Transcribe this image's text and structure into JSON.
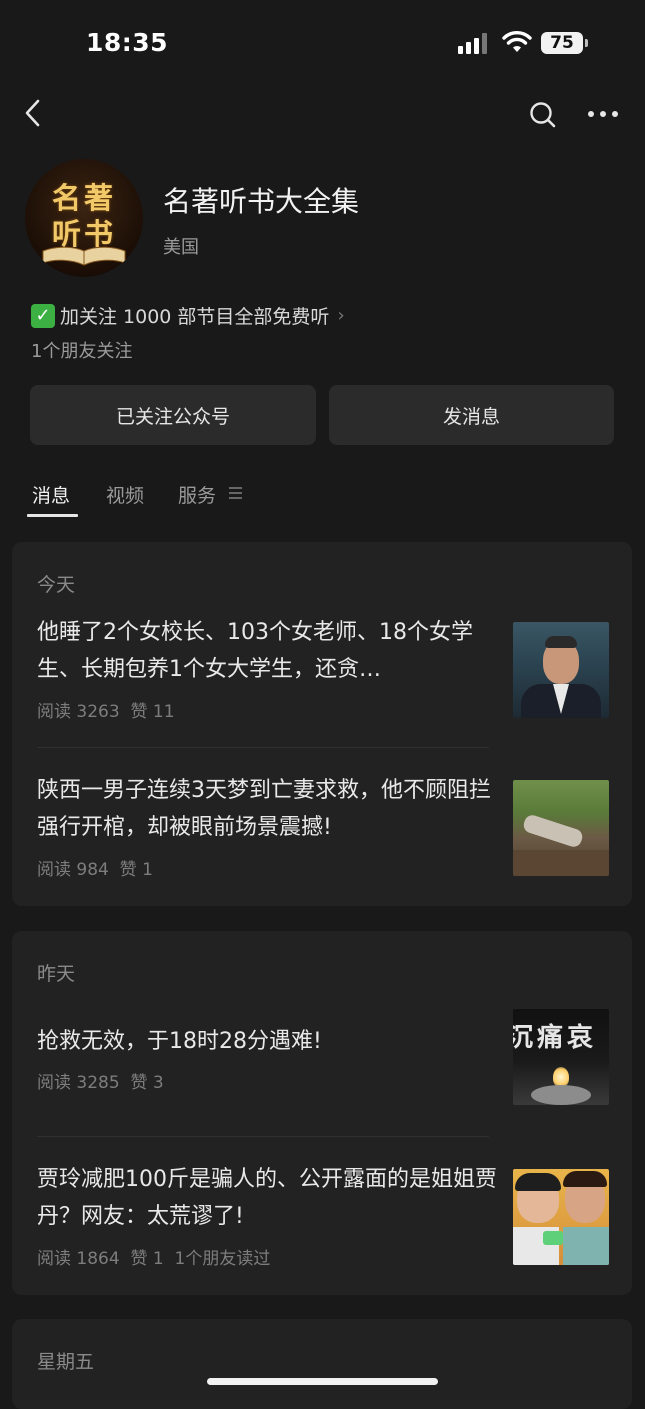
{
  "status_bar": {
    "time": "18:35",
    "battery": "75"
  },
  "profile": {
    "avatar_text_line1": "名著",
    "avatar_text_line2": "听书",
    "name": "名著听书大全集",
    "region": "美国",
    "promo": "加关注 1000 部节目全部免费听",
    "friends_following": "1个朋友关注"
  },
  "actions": {
    "followed_label": "已关注公众号",
    "message_label": "发消息"
  },
  "tabs": [
    {
      "label": "消息"
    },
    {
      "label": "视频"
    },
    {
      "label": "服务"
    }
  ],
  "groups": [
    {
      "date": "今天",
      "articles": [
        {
          "title": "他睡了2个女校长、103个女老师、18个女学生、长期包养1个女大学生，还贪…",
          "reads": "阅读 3263",
          "likes": "赞 11"
        },
        {
          "title": "陕西一男子连续3天梦到亡妻求救，他不顾阻拦强行开棺，却被眼前场景震撼!",
          "reads": "阅读 984",
          "likes": "赞 1"
        }
      ]
    },
    {
      "date": "昨天",
      "articles": [
        {
          "title": "抢救无效，于18时28分遇难!",
          "reads": "阅读 3285",
          "likes": "赞 3",
          "thumb_text": "沉痛哀"
        },
        {
          "title": "贾玲减肥100斤是骗人的、公开露面的是姐姐贾丹？网友：太荒谬了!",
          "reads": "阅读 1864",
          "likes": "赞 1",
          "friends_read": "1个朋友读过"
        }
      ]
    },
    {
      "date": "星期五"
    }
  ],
  "colors": {
    "background": "#191919",
    "card": "#222222",
    "button": "#2b2b2b",
    "check": "#3cb043"
  }
}
